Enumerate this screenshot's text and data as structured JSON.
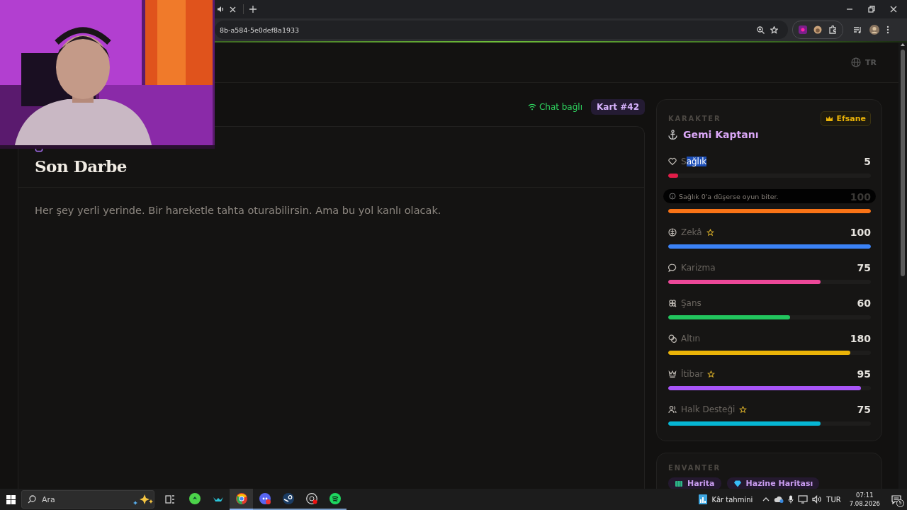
{
  "browser": {
    "url": "8b-a584-5e0def8a1933"
  },
  "page_header": {
    "language": "TR"
  },
  "status": {
    "chat": "Chat bağlı",
    "card": "Kart #42"
  },
  "card": {
    "title": "Son Darbe",
    "text": "Her şey yerli yerinde. Bir hareketle tahta oturabilirsin. Ama bu yol kanlı olacak."
  },
  "character": {
    "heading": "KARAKTER",
    "rank": "Efsane",
    "name": "Gemi Kaptanı",
    "tooltip": "Sağlık 0'a düşerse oyun biter.",
    "stats": [
      {
        "label_parts": [
          {
            "text": "S",
            "selected": false
          },
          {
            "text": "ağlık",
            "selected": true
          }
        ],
        "starred": false,
        "value": "5",
        "level": 0.05,
        "color": "#e11d48"
      },
      {
        "value": "100",
        "level": 1,
        "color": "#f97316"
      },
      {
        "label": "Zekâ",
        "starred": true,
        "value": "100",
        "level": 1,
        "color": "#3b82f6"
      },
      {
        "label": "Karizma",
        "starred": false,
        "value": "75",
        "level": 0.75,
        "color": "#ec4899"
      },
      {
        "label": "Şans",
        "starred": false,
        "value": "60",
        "level": 0.6,
        "color": "#22c55e"
      },
      {
        "label": "Altın",
        "starred": false,
        "value": "180",
        "level": 0.9,
        "color": "#eab308"
      },
      {
        "label": "İtibar",
        "starred": true,
        "value": "95",
        "level": 0.95,
        "color": "#a855f7"
      },
      {
        "label": "Halk Desteği",
        "starred": true,
        "value": "75",
        "level": 0.75,
        "color": "#06b6d4"
      }
    ]
  },
  "inventory": {
    "heading": "ENVANTER",
    "items": [
      {
        "label": "Harita"
      },
      {
        "label": "Hazine Haritası"
      }
    ]
  },
  "taskbar": {
    "search": {
      "placeholder": "Ara"
    },
    "apps": [
      {
        "running": false,
        "selected": false
      },
      {
        "running": false,
        "selected": false
      },
      {
        "running": true,
        "selected": true
      },
      {
        "running": true,
        "selected": false
      },
      {
        "running": true,
        "selected": false
      },
      {
        "running": true,
        "selected": false
      },
      {
        "running": true,
        "selected": false
      }
    ],
    "weather": "Kâr tahmini",
    "language": "TUR",
    "time": "07:11",
    "date": "7.08.2026",
    "notifications": "5"
  }
}
